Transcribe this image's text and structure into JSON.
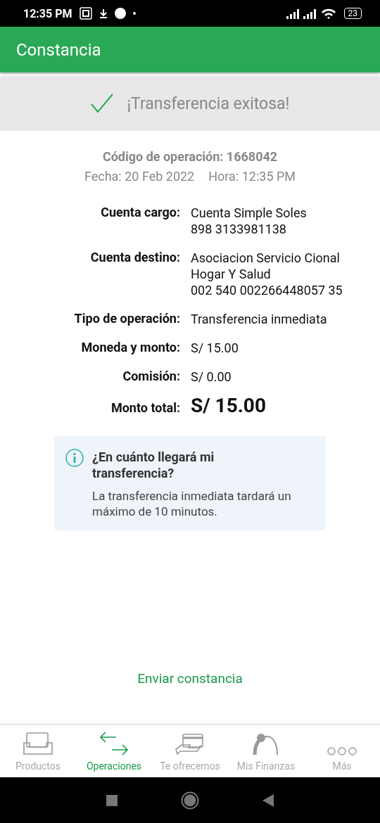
{
  "status_bar": {
    "time": "12:35 PM",
    "battery": "23"
  },
  "app_bar": {
    "title": "Constancia"
  },
  "banner": {
    "message": "¡Transferencia exitosa!"
  },
  "operation": {
    "code": "Código de operación: 1668042",
    "date": "Fecha: 20 Feb 2022",
    "time": "Hora: 12:35 PM"
  },
  "details": [
    {
      "kind": "normal",
      "label": "Cuenta cargo:",
      "lines": [
        "Cuenta Simple Soles",
        "898 3133981138"
      ]
    },
    {
      "kind": "normal",
      "label": "Cuenta destino:",
      "lines": [
        "Asociacion Servicio Cional",
        "Hogar Y Salud",
        "002 540 002266448057 35"
      ]
    },
    {
      "kind": "normal",
      "label": "Tipo de operación:",
      "lines": [
        "Transferencia inmediata"
      ]
    },
    {
      "kind": "normal",
      "label": "Moneda y monto:",
      "lines": [
        "S/ 15.00"
      ]
    },
    {
      "kind": "normal",
      "label": "Comisión:",
      "lines": [
        "S/ 0.00"
      ]
    },
    {
      "kind": "total",
      "label": "Monto total:",
      "lines": [
        "S/ 15.00"
      ]
    }
  ],
  "info_card": {
    "title": "¿En cuánto llegará mi transferencia?",
    "body": "La transferencia inmediata tardará un máximo de 10 minutos."
  },
  "send_link": "Enviar constancia",
  "bottom_nav": [
    {
      "label": "Productos",
      "kind": "tray",
      "selected": false
    },
    {
      "label": "Operaciones",
      "kind": "arrows",
      "selected": true
    },
    {
      "label": "Te ofrecemos",
      "kind": "hand",
      "selected": false
    },
    {
      "label": "Mis Finanzas",
      "kind": "gauge",
      "selected": false
    },
    {
      "label": "Más",
      "kind": "dots",
      "selected": false
    }
  ]
}
